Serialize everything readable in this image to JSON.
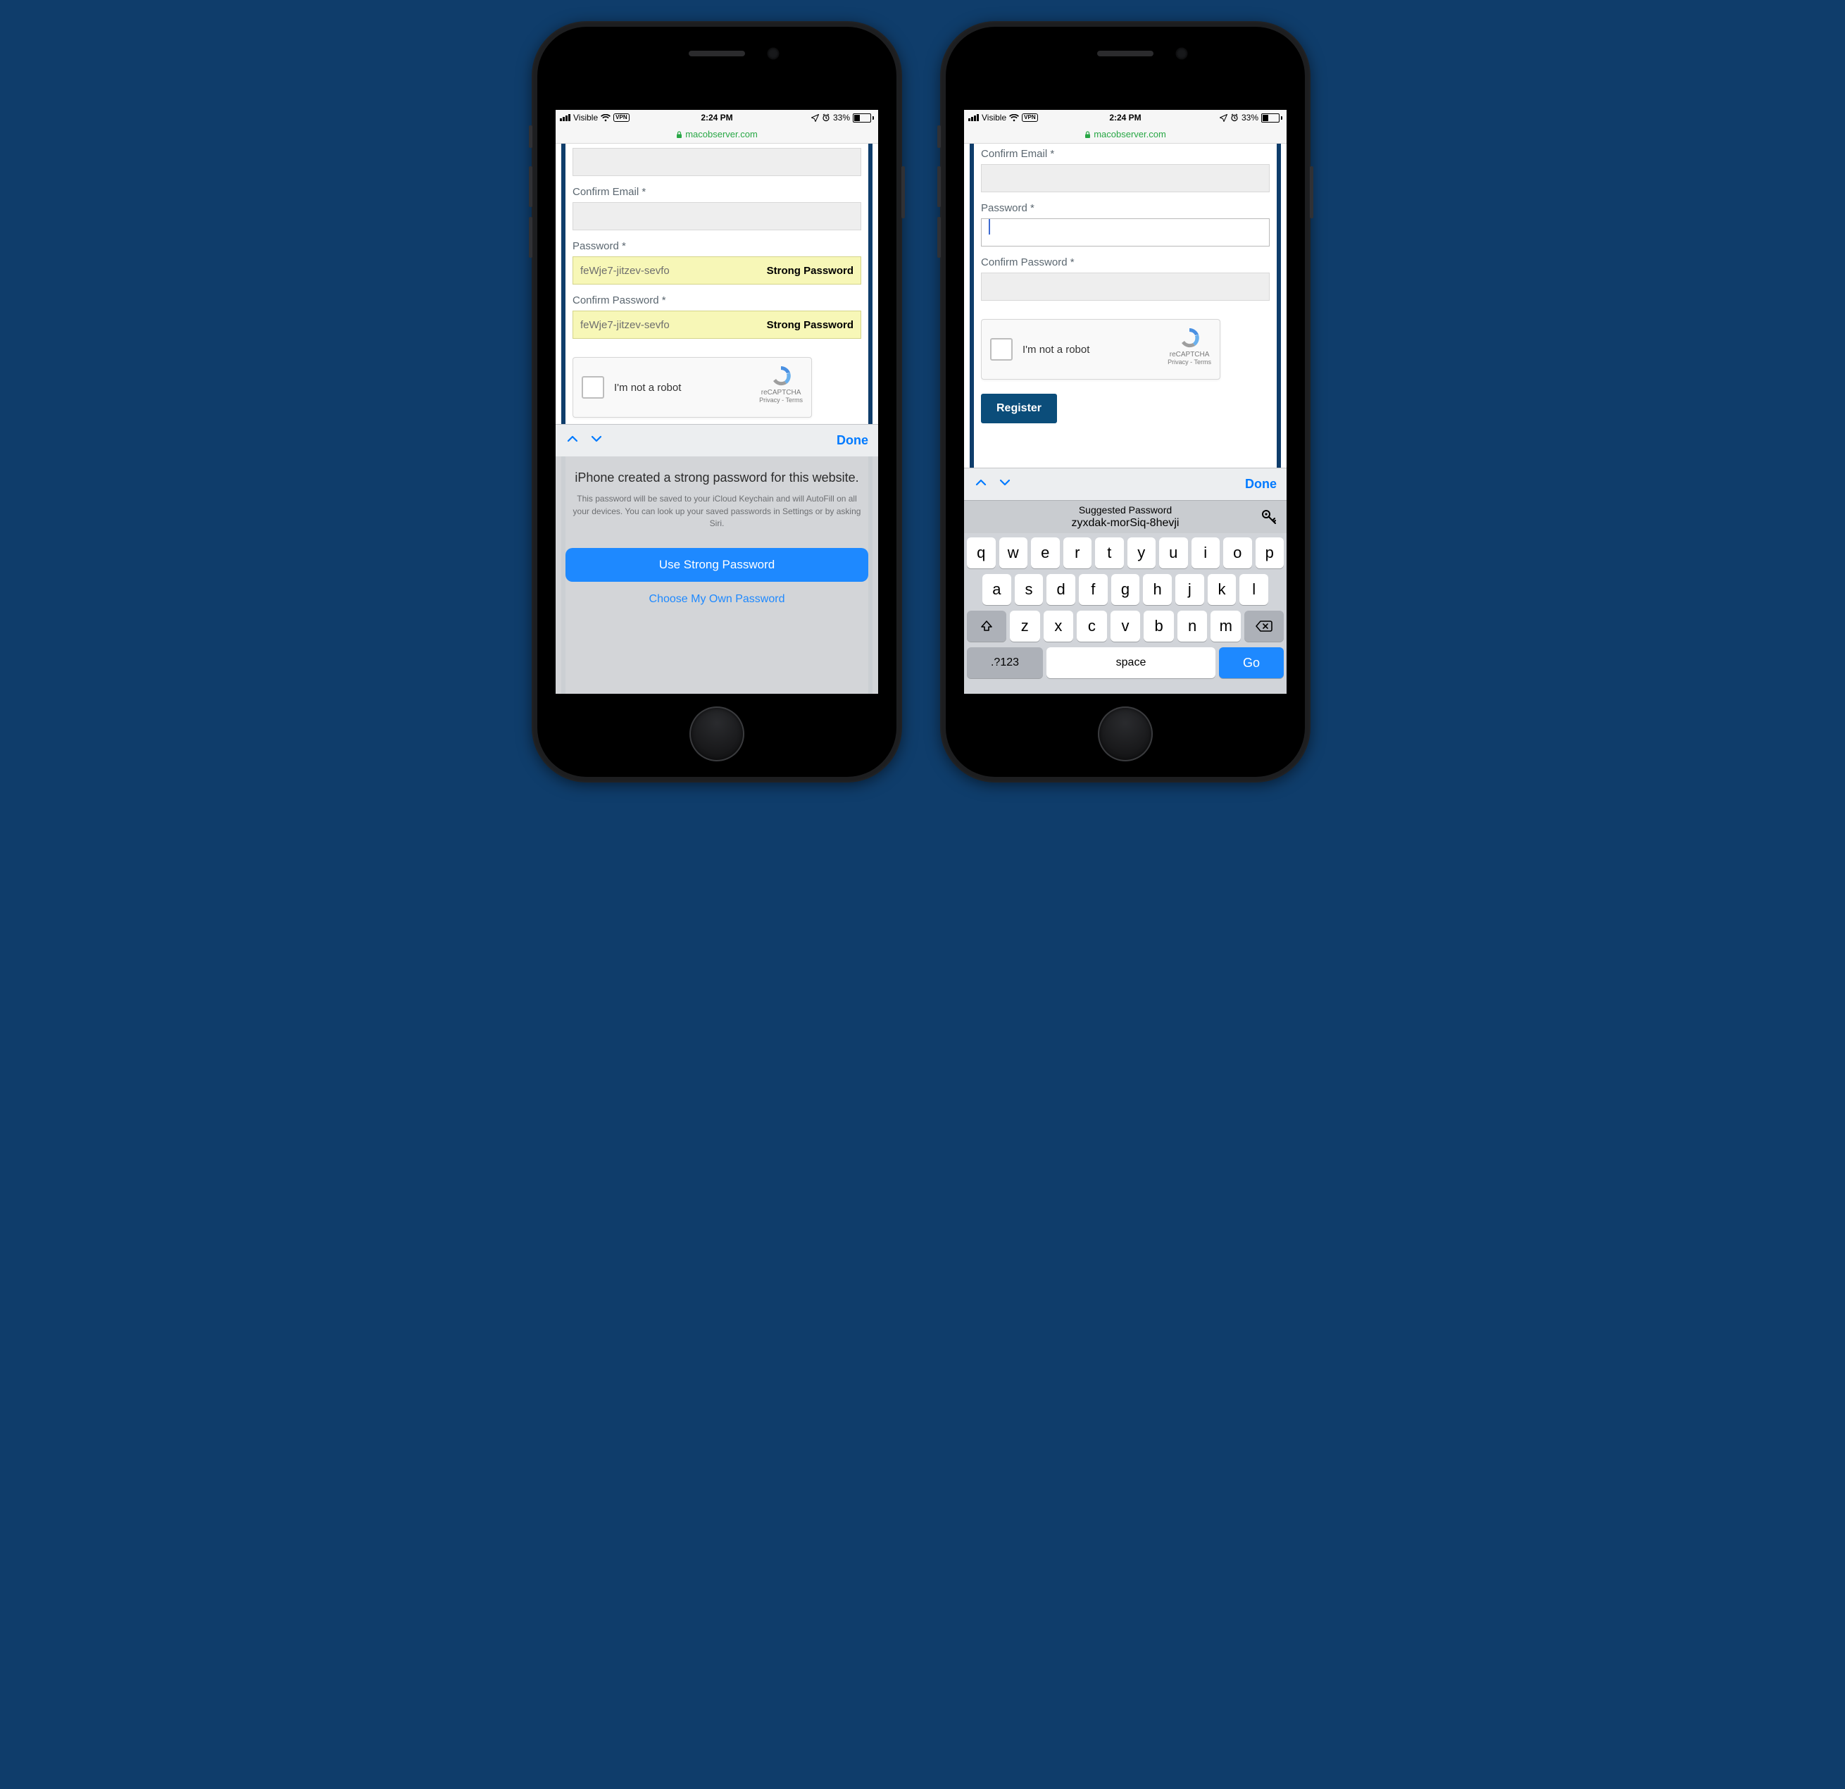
{
  "status": {
    "carrier": "Visible",
    "vpn": "VPN",
    "time": "2:24 PM",
    "battery_pct": "33%"
  },
  "urlbar": {
    "domain": "macobserver.com"
  },
  "form": {
    "confirm_email_label": "Confirm Email *",
    "password_label": "Password *",
    "confirm_password_label": "Confirm Password *",
    "suggested_password_display": "feWje7-jitzev-sevfo",
    "strong_badge": "Strong Password"
  },
  "recaptcha": {
    "text": "I'm not a robot",
    "brand": "reCAPTCHA",
    "links": "Privacy - Terms"
  },
  "register_label": "Register",
  "accessory": {
    "done": "Done"
  },
  "sheet": {
    "title": "iPhone created a strong password for this website.",
    "body": "This password will be saved to your iCloud Keychain and will AutoFill on all your devices. You can look up your saved passwords in Settings or by asking Siri.",
    "primary": "Use Strong Password",
    "secondary": "Choose My Own Password"
  },
  "keyboard": {
    "suggestion_title": "Suggested Password",
    "suggestion_value": "zyxdak-morSiq-8hevji",
    "row1": [
      "q",
      "w",
      "e",
      "r",
      "t",
      "y",
      "u",
      "i",
      "o",
      "p"
    ],
    "row2": [
      "a",
      "s",
      "d",
      "f",
      "g",
      "h",
      "j",
      "k",
      "l"
    ],
    "row3": [
      "z",
      "x",
      "c",
      "v",
      "b",
      "n",
      "m"
    ],
    "numkey": ".?123",
    "space": "space",
    "go": "Go"
  }
}
